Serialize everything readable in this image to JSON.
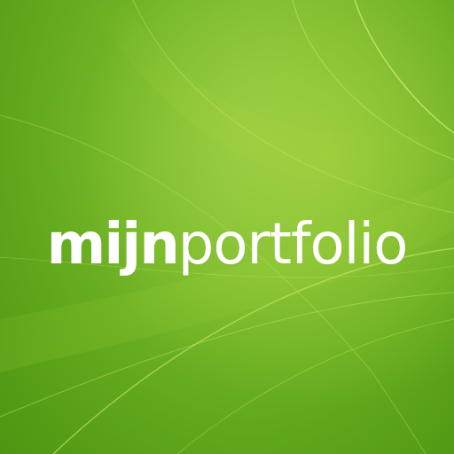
{
  "logo": {
    "text_bold": "mijn",
    "text_light": "portfolio"
  },
  "colors": {
    "background_light": "#8dc63f",
    "background_mid": "#76b82a",
    "background_dark": "#4e9512",
    "wave_highlight": "#c8e86a",
    "text": "#ffffff"
  }
}
